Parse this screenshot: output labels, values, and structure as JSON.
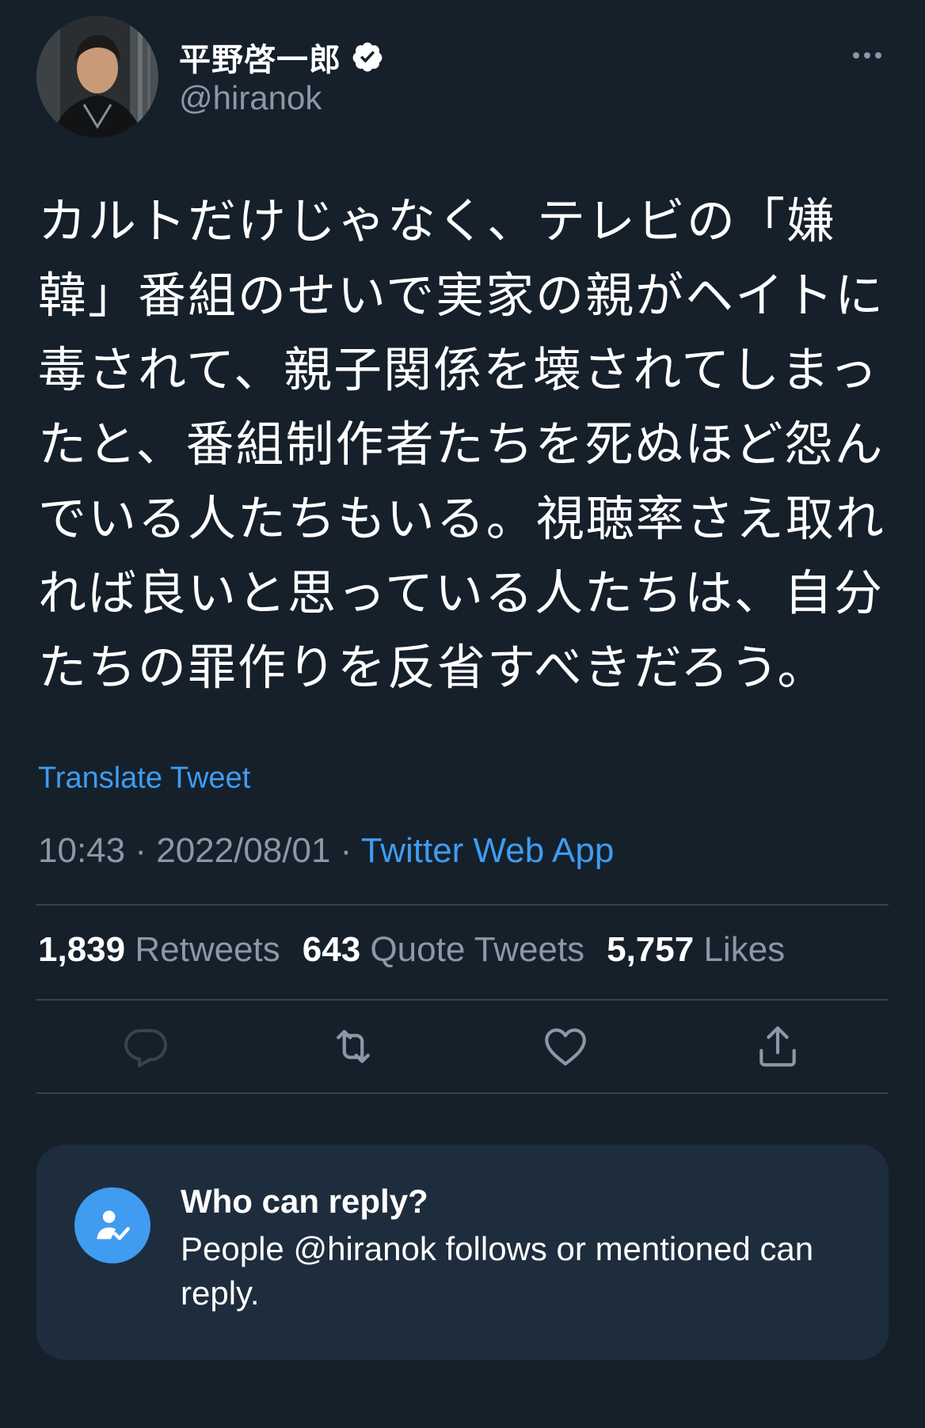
{
  "author": {
    "display_name": "平野啓一郎",
    "handle": "@hiranok",
    "verified": true
  },
  "tweet": {
    "text": "カルトだけじゃなく、テレビの「嫌韓」番組のせいで実家の親がヘイトに毒されて、親子関係を壊されてしまったと、番組制作者たちを死ぬほど怨んでいる人たちもいる。視聴率さえ取れれば良いと思っている人たちは、自分たちの罪作りを反省すべきだろう。",
    "translate_label": "Translate Tweet",
    "time": "10:43",
    "date": "2022/08/01",
    "separator": " · ",
    "source": "Twitter Web App"
  },
  "stats": {
    "retweets_count": "1,839",
    "retweets_label": "Retweets",
    "quotes_count": "643",
    "quotes_label": "Quote Tweets",
    "likes_count": "5,757",
    "likes_label": "Likes"
  },
  "actions": {
    "icons": [
      "reply-icon",
      "retweet-icon",
      "like-icon",
      "share-icon"
    ]
  },
  "reply_restriction": {
    "title": "Who can reply?",
    "description": "People @hiranok follows or mentioned can reply."
  },
  "colors": {
    "background": "#15202b",
    "accent": "#3f9cf0",
    "secondary_text": "#8b98a5",
    "card": "#1e2d3d"
  }
}
